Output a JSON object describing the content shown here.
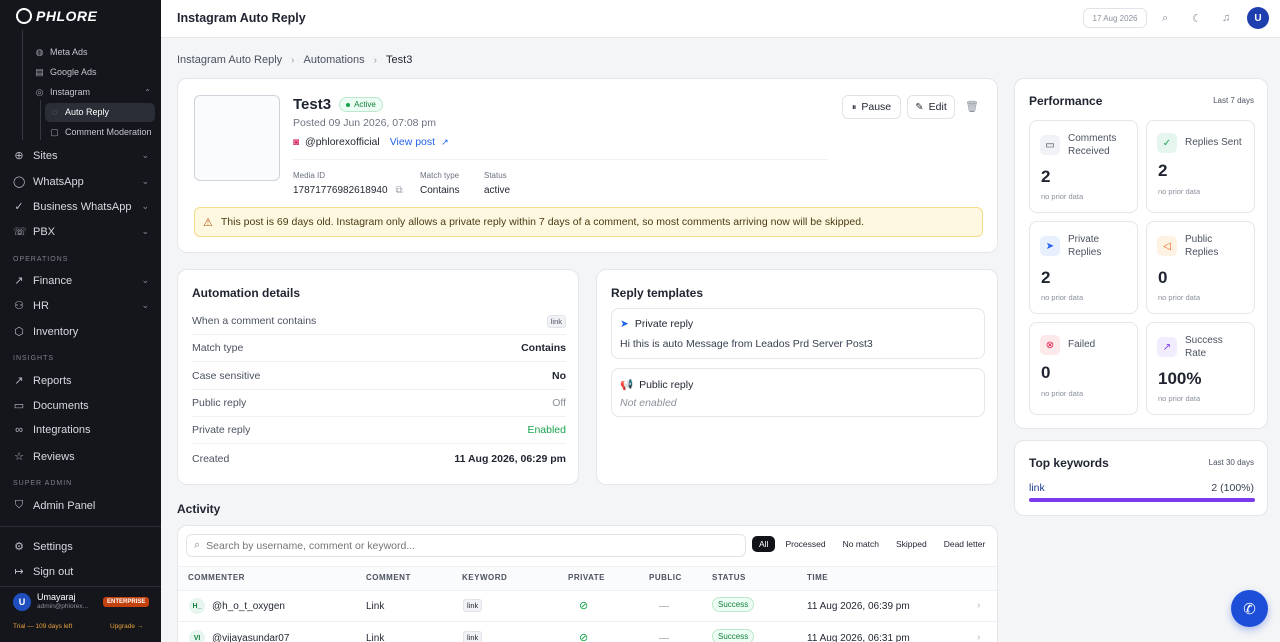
{
  "app": {
    "logo_text": "PHLORE"
  },
  "sidebar": {
    "subitems": [
      {
        "label": "Meta Ads",
        "icon": "globe-icon"
      },
      {
        "label": "Google Ads",
        "icon": "chart-icon"
      },
      {
        "label": "Instagram",
        "icon": "instagram-icon"
      },
      {
        "label": "Auto Reply",
        "icon": "chat-icon"
      },
      {
        "label": "Comment Moderation",
        "icon": "comment-icon"
      }
    ],
    "nav1": [
      {
        "label": "Sites"
      },
      {
        "label": "WhatsApp"
      },
      {
        "label": "Business WhatsApp"
      },
      {
        "label": "PBX"
      }
    ],
    "sec_operations": "OPERATIONS",
    "nav2": [
      {
        "label": "Finance"
      },
      {
        "label": "HR"
      },
      {
        "label": "Inventory"
      }
    ],
    "sec_insights": "INSIGHTS",
    "nav3": [
      {
        "label": "Reports"
      },
      {
        "label": "Documents"
      },
      {
        "label": "Integrations"
      },
      {
        "label": "Reviews"
      }
    ],
    "sec_super": "SUPER ADMIN",
    "admin": "Admin Panel",
    "settings": "Settings",
    "signout": "Sign out",
    "user": {
      "initial": "U",
      "name": "Umayaraj",
      "email": "admin@phlorex...",
      "plan": "ENTERPRISE",
      "trial": "Trial — 109 days left",
      "upgrade": "Upgrade →"
    }
  },
  "topbar": {
    "title": "Instagram Auto Reply",
    "date": "17 Aug 2026",
    "user_initial": "U"
  },
  "breadcrumb": [
    "Instagram Auto Reply",
    "Automations",
    "Test3"
  ],
  "post": {
    "title": "Test3",
    "status": "Active",
    "posted": "Posted 09 Jun 2026, 07:08 pm",
    "handle": "@phlorexofficial",
    "view_post": "View post",
    "media_id_label": "Media ID",
    "media_id": "17871776982618940",
    "match_label": "Match type",
    "match": "Contains",
    "status_label": "Status",
    "status_value": "active",
    "pause": "Pause",
    "edit": "Edit",
    "warning": "This post is 69 days old. Instagram only allows a private reply within 7 days of a comment, so most comments arriving now will be skipped."
  },
  "automation": {
    "title": "Automation details",
    "rows": [
      {
        "label": "When a comment contains",
        "value": "link"
      },
      {
        "label": "Match type",
        "value": "Contains"
      },
      {
        "label": "Case sensitive",
        "value": "No"
      },
      {
        "label": "Public reply",
        "value": "Off"
      },
      {
        "label": "Private reply",
        "value": "Enabled"
      },
      {
        "label": "Created",
        "value": "11 Aug 2026, 06:29 pm"
      }
    ]
  },
  "templates": {
    "title": "Reply templates",
    "private_title": "Private reply",
    "private_text": "Hi this is auto Message from Leados Prd Server Post3",
    "public_title": "Public reply",
    "public_text": "Not enabled"
  },
  "performance": {
    "title": "Performance",
    "range": "Last 7 days",
    "stats": [
      {
        "name": "Comments Received",
        "value": "2",
        "note": "no prior data"
      },
      {
        "name": "Replies Sent",
        "value": "2",
        "note": "no prior data"
      },
      {
        "name": "Private Replies",
        "value": "2",
        "note": "no prior data"
      },
      {
        "name": "Public Replies",
        "value": "0",
        "note": "no prior data"
      },
      {
        "name": "Failed",
        "value": "0",
        "note": "no prior data"
      },
      {
        "name": "Success Rate",
        "value": "100%",
        "note": "no prior data"
      }
    ]
  },
  "keywords": {
    "title": "Top keywords",
    "range": "Last 30 days",
    "items": [
      {
        "word": "link",
        "count": "2 (100%)",
        "share": 1.0
      }
    ]
  },
  "activity": {
    "title": "Activity",
    "search_placeholder": "Search by username, comment or keyword...",
    "filters": [
      "All",
      "Processed",
      "No match",
      "Skipped",
      "Dead letter"
    ],
    "columns": [
      "COMMENTER",
      "COMMENT",
      "KEYWORD",
      "PRIVATE",
      "PUBLIC",
      "STATUS",
      "TIME"
    ],
    "rows": [
      {
        "initials": "H_",
        "user": "@h_o_t_oxygen",
        "comment": "Link",
        "keyword": "link",
        "public": "—",
        "status": "Success",
        "time": "11 Aug 2026, 06:39 pm"
      },
      {
        "initials": "VI",
        "user": "@vijayasundar07",
        "comment": "Link",
        "keyword": "link",
        "public": "—",
        "status": "Success",
        "time": "11 Aug 2026, 06:31 pm"
      }
    ]
  }
}
